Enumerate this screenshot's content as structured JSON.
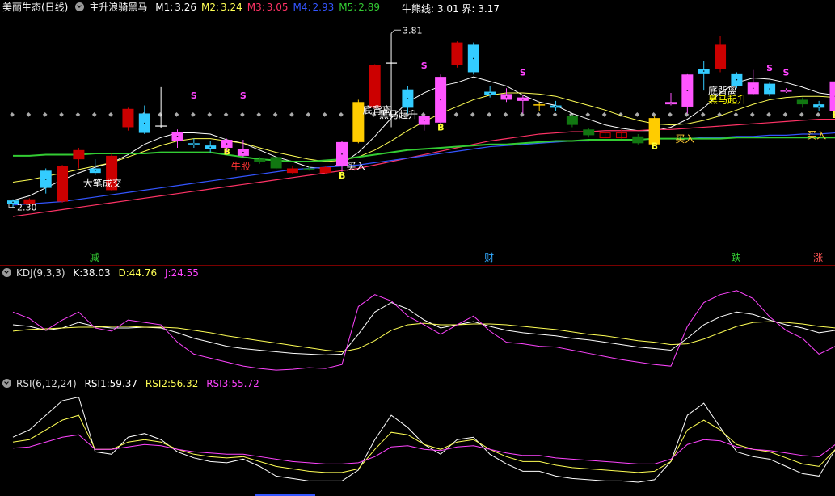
{
  "header": {
    "stock_title": "美丽生态(日线)",
    "indicator_name": "主升浪骑黑马",
    "ma": [
      {
        "label": "M1:",
        "value": "3.26",
        "color": "#ffffff"
      },
      {
        "label": "M2:",
        "value": "3.24",
        "color": "#ffff55"
      },
      {
        "label": "M3:",
        "value": "3.05",
        "color": "#ff3366"
      },
      {
        "label": "M4:",
        "value": "2.93",
        "color": "#3355ff"
      },
      {
        "label": "M5:",
        "value": "2.89",
        "color": "#33cc33"
      }
    ],
    "niu_label": "牛熊线:",
    "niu_value": "3.01",
    "jie_label": "界:",
    "jie_value": "3.17"
  },
  "kdj": {
    "title": "KDJ(9,3,3)",
    "k_label": "K:",
    "k_value": "38.03",
    "d_label": "D:",
    "d_value": "44.76",
    "j_label": "J:",
    "j_value": "24.55"
  },
  "rsi": {
    "title": "RSI(6,12,24)",
    "r1_label": "RSI1:",
    "r1_value": "59.37",
    "r2_label": "RSI2:",
    "r2_value": "56.32",
    "r3_label": "RSI3:",
    "r3_value": "55.72"
  },
  "chart_data": {
    "type": "candlestick",
    "price_range": [
      2.2,
      3.95
    ],
    "high_label": "3.81",
    "low_label": "2.30",
    "colors": {
      "up": "#cc0000",
      "down": "#33ccff",
      "doji": "#ffffff",
      "pink": "#ff55ff",
      "gold": "#ffcc00",
      "green": "#117711"
    },
    "candles": [
      {
        "o": 2.34,
        "c": 2.31,
        "h": 2.35,
        "l": 2.28,
        "col": "down"
      },
      {
        "o": 2.31,
        "c": 2.35,
        "h": 2.36,
        "l": 2.3,
        "col": "up"
      },
      {
        "o": 2.45,
        "c": 2.6,
        "h": 2.62,
        "l": 2.4,
        "col": "down"
      },
      {
        "o": 2.33,
        "c": 2.64,
        "h": 2.65,
        "l": 2.32,
        "col": "up"
      },
      {
        "o": 2.7,
        "c": 2.78,
        "h": 2.8,
        "l": 2.62,
        "col": "up"
      },
      {
        "o": 2.62,
        "c": 2.58,
        "h": 2.7,
        "l": 2.56,
        "col": "down"
      },
      {
        "o": 2.43,
        "c": 2.73,
        "h": 2.75,
        "l": 2.42,
        "col": "up"
      },
      {
        "o": 2.98,
        "c": 3.14,
        "h": 3.15,
        "l": 2.95,
        "col": "up"
      },
      {
        "o": 3.1,
        "c": 2.93,
        "h": 3.17,
        "l": 2.92,
        "col": "down"
      },
      {
        "o": 2.98,
        "c": 2.99,
        "h": 3.33,
        "l": 2.97,
        "col": "doji"
      },
      {
        "o": 2.86,
        "c": 2.94,
        "h": 2.96,
        "l": 2.8,
        "col": "pink"
      },
      {
        "o": 2.84,
        "c": 2.84,
        "h": 2.88,
        "l": 2.8,
        "col": "down"
      },
      {
        "o": 2.79,
        "c": 2.82,
        "h": 2.86,
        "l": 2.76,
        "col": "down"
      },
      {
        "o": 2.8,
        "c": 2.87,
        "h": 2.88,
        "l": 2.76,
        "col": "pink"
      },
      {
        "o": 2.73,
        "c": 2.79,
        "h": 2.87,
        "l": 2.72,
        "col": "pink"
      },
      {
        "o": 2.68,
        "c": 2.7,
        "h": 2.72,
        "l": 2.66,
        "col": "green"
      },
      {
        "o": 2.72,
        "c": 2.62,
        "h": 2.73,
        "l": 2.61,
        "col": "green"
      },
      {
        "o": 2.62,
        "c": 2.58,
        "h": 2.64,
        "l": 2.57,
        "col": "up"
      },
      {
        "o": 2.62,
        "c": 2.62,
        "h": 2.64,
        "l": 2.6,
        "col": "green"
      },
      {
        "o": 2.58,
        "c": 2.63,
        "h": 2.64,
        "l": 2.57,
        "col": "up"
      },
      {
        "o": 2.64,
        "c": 2.85,
        "h": 2.86,
        "l": 2.59,
        "col": "pink"
      },
      {
        "o": 2.85,
        "c": 3.2,
        "h": 3.22,
        "l": 2.84,
        "col": "gold"
      },
      {
        "o": 3.15,
        "c": 3.52,
        "h": 3.53,
        "l": 3.14,
        "col": "up"
      },
      {
        "o": 3.0,
        "c": 3.54,
        "h": 3.8,
        "l": 2.98,
        "col": "doji"
      },
      {
        "o": 3.15,
        "c": 3.31,
        "h": 3.34,
        "l": 3.1,
        "col": "down"
      },
      {
        "o": 3.0,
        "c": 3.08,
        "h": 3.1,
        "l": 2.95,
        "col": "pink"
      },
      {
        "o": 3.02,
        "c": 3.42,
        "h": 3.44,
        "l": 3.0,
        "col": "pink"
      },
      {
        "o": 3.52,
        "c": 3.72,
        "h": 3.73,
        "l": 3.5,
        "col": "up"
      },
      {
        "o": 3.7,
        "c": 3.46,
        "h": 3.72,
        "l": 3.44,
        "col": "down"
      },
      {
        "o": 3.26,
        "c": 3.29,
        "h": 3.34,
        "l": 3.24,
        "col": "down"
      },
      {
        "o": 3.22,
        "c": 3.27,
        "h": 3.32,
        "l": 3.2,
        "col": "pink"
      },
      {
        "o": 3.21,
        "c": 3.24,
        "h": 3.26,
        "l": 3.1,
        "col": "pink"
      },
      {
        "o": 3.18,
        "c": 3.17,
        "h": 3.2,
        "l": 3.12,
        "col": "gold"
      },
      {
        "o": 3.17,
        "c": 3.15,
        "h": 3.21,
        "l": 3.12,
        "col": "down"
      },
      {
        "o": 3.08,
        "c": 3.0,
        "h": 3.09,
        "l": 2.98,
        "col": "green"
      },
      {
        "o": 2.96,
        "c": 2.91,
        "h": 2.97,
        "l": 2.89,
        "col": "green"
      },
      {
        "o": 2.92,
        "c": 2.93,
        "h": 2.95,
        "l": 2.9,
        "col": "up"
      },
      {
        "o": 2.92,
        "c": 2.93,
        "h": 2.96,
        "l": 2.88,
        "col": "up"
      },
      {
        "o": 2.84,
        "c": 2.9,
        "h": 2.92,
        "l": 2.83,
        "col": "green"
      },
      {
        "o": 2.83,
        "c": 3.06,
        "h": 3.08,
        "l": 2.82,
        "col": "gold"
      },
      {
        "o": 3.18,
        "c": 3.2,
        "h": 3.28,
        "l": 3.17,
        "col": "pink"
      },
      {
        "o": 3.16,
        "c": 3.44,
        "h": 3.45,
        "l": 3.1,
        "col": "pink"
      },
      {
        "o": 3.45,
        "c": 3.49,
        "h": 3.56,
        "l": 3.3,
        "col": "down"
      },
      {
        "o": 3.49,
        "c": 3.7,
        "h": 3.78,
        "l": 3.46,
        "col": "up"
      },
      {
        "o": 3.45,
        "c": 3.34,
        "h": 3.46,
        "l": 3.32,
        "col": "down"
      },
      {
        "o": 3.37,
        "c": 3.27,
        "h": 3.48,
        "l": 3.26,
        "col": "pink"
      },
      {
        "o": 3.36,
        "c": 3.27,
        "h": 3.37,
        "l": 3.25,
        "col": "down"
      },
      {
        "o": 3.3,
        "c": 3.3,
        "h": 3.32,
        "l": 3.28,
        "col": "pink"
      },
      {
        "o": 3.18,
        "c": 3.22,
        "h": 3.24,
        "l": 3.15,
        "col": "green"
      },
      {
        "o": 3.15,
        "c": 3.18,
        "h": 3.21,
        "l": 3.12,
        "col": "down"
      },
      {
        "o": 3.12,
        "c": 3.38,
        "h": 3.4,
        "l": 3.1,
        "col": "pink"
      }
    ],
    "dots_level": 3.09,
    "ma_lines": {
      "M1": [
        2.34,
        2.38,
        2.45,
        2.52,
        2.58,
        2.63,
        2.67,
        2.74,
        2.83,
        2.89,
        2.93,
        2.93,
        2.92,
        2.87,
        2.84,
        2.78,
        2.72,
        2.68,
        2.63,
        2.62,
        2.66,
        2.76,
        2.9,
        3.06,
        3.2,
        3.28,
        3.34,
        3.37,
        3.42,
        3.38,
        3.34,
        3.26,
        3.2,
        3.17,
        3.1,
        3.05,
        3.0,
        2.97,
        2.95,
        2.95,
        2.98,
        3.05,
        3.15,
        3.28,
        3.37,
        3.41,
        3.4,
        3.37,
        3.33,
        3.28,
        3.26
      ],
      "M2": [
        2.5,
        2.52,
        2.55,
        2.58,
        2.61,
        2.64,
        2.67,
        2.72,
        2.77,
        2.82,
        2.86,
        2.88,
        2.88,
        2.86,
        2.84,
        2.8,
        2.76,
        2.73,
        2.7,
        2.68,
        2.69,
        2.72,
        2.78,
        2.86,
        2.95,
        3.03,
        3.1,
        3.16,
        3.22,
        3.26,
        3.28,
        3.28,
        3.27,
        3.25,
        3.21,
        3.17,
        3.13,
        3.08,
        3.04,
        3.01,
        3.0,
        3.01,
        3.04,
        3.08,
        3.13,
        3.18,
        3.22,
        3.24,
        3.25,
        3.25,
        3.24
      ],
      "M3": [
        2.2,
        2.22,
        2.24,
        2.26,
        2.28,
        2.3,
        2.32,
        2.34,
        2.36,
        2.38,
        2.4,
        2.42,
        2.44,
        2.46,
        2.48,
        2.5,
        2.52,
        2.54,
        2.56,
        2.58,
        2.6,
        2.62,
        2.65,
        2.68,
        2.71,
        2.74,
        2.77,
        2.8,
        2.83,
        2.86,
        2.88,
        2.9,
        2.92,
        2.93,
        2.94,
        2.94,
        2.95,
        2.95,
        2.95,
        2.96,
        2.96,
        2.97,
        2.98,
        2.99,
        3.0,
        3.01,
        3.02,
        3.03,
        3.04,
        3.05,
        3.05
      ],
      "M4": [
        2.3,
        2.31,
        2.32,
        2.33,
        2.35,
        2.37,
        2.39,
        2.41,
        2.43,
        2.45,
        2.47,
        2.49,
        2.51,
        2.53,
        2.55,
        2.57,
        2.59,
        2.61,
        2.62,
        2.63,
        2.64,
        2.65,
        2.67,
        2.69,
        2.71,
        2.73,
        2.75,
        2.77,
        2.79,
        2.81,
        2.82,
        2.83,
        2.84,
        2.85,
        2.86,
        2.86,
        2.87,
        2.87,
        2.87,
        2.88,
        2.88,
        2.88,
        2.89,
        2.89,
        2.9,
        2.9,
        2.91,
        2.91,
        2.92,
        2.92,
        2.93
      ],
      "M5": [
        2.73,
        2.73,
        2.74,
        2.74,
        2.74,
        2.75,
        2.75,
        2.75,
        2.75,
        2.76,
        2.76,
        2.76,
        2.76,
        2.74,
        2.72,
        2.7,
        2.69,
        2.68,
        2.68,
        2.69,
        2.7,
        2.72,
        2.74,
        2.76,
        2.78,
        2.79,
        2.8,
        2.81,
        2.82,
        2.83,
        2.83,
        2.84,
        2.85,
        2.86,
        2.86,
        2.87,
        2.87,
        2.87,
        2.87,
        2.88,
        2.88,
        2.88,
        2.88,
        2.88,
        2.89,
        2.89,
        2.89,
        2.89,
        2.89,
        2.89,
        2.89
      ]
    },
    "annotations": [
      {
        "text": "大笔成交",
        "i": 5,
        "price": 2.46,
        "color": "#ffffff"
      },
      {
        "text": "牛股",
        "i": 14,
        "price": 2.61,
        "color": "#ff3333"
      },
      {
        "text": "买入",
        "i": 21,
        "price": 2.61,
        "color": "#ffffff"
      },
      {
        "text": "底背离",
        "i": 22,
        "price": 3.1,
        "color": "#ffffff"
      },
      {
        "text": "黑马起升",
        "i": 23,
        "price": 3.06,
        "color": "#ffffff"
      },
      {
        "text": "买入",
        "i": 41,
        "price": 2.85,
        "color": "#ffcc33"
      },
      {
        "text": "底背离",
        "i": 43,
        "price": 3.27,
        "color": "#ffffff"
      },
      {
        "text": "黑马起升",
        "i": 43,
        "price": 3.19,
        "color": "#ffff00"
      },
      {
        "text": "买入",
        "i": 49,
        "price": 2.88,
        "color": "#ffcc33"
      }
    ],
    "markers": [
      {
        "text": "S",
        "i": 11,
        "price": 3.23,
        "color": "#ff44ff"
      },
      {
        "text": "S",
        "i": 14,
        "price": 3.23,
        "color": "#ff44ff"
      },
      {
        "text": "S",
        "i": 25,
        "price": 3.49,
        "color": "#ff44ff"
      },
      {
        "text": "S",
        "i": 31,
        "price": 3.43,
        "color": "#ff44ff"
      },
      {
        "text": "S",
        "i": 46,
        "price": 3.47,
        "color": "#ff44ff"
      },
      {
        "text": "S",
        "i": 47,
        "price": 3.43,
        "color": "#ff44ff"
      },
      {
        "text": "B",
        "i": 13,
        "price": 2.74,
        "color": "#ffff33"
      },
      {
        "text": "B",
        "i": 20,
        "price": 2.53,
        "color": "#ffff33"
      },
      {
        "text": "B",
        "i": 26,
        "price": 2.95,
        "color": "#ffff33"
      },
      {
        "text": "B",
        "i": 39,
        "price": 2.79,
        "color": "#ffff33"
      },
      {
        "text": "B",
        "i": 50,
        "price": 3.06,
        "color": "#ffff33"
      }
    ],
    "bottom_labels": [
      {
        "text": "减",
        "i": 5,
        "color": "#33cc33"
      },
      {
        "text": "财",
        "i": 29,
        "color": "#33aaff"
      },
      {
        "text": "跌",
        "i": 44,
        "color": "#33cc33"
      },
      {
        "text": "涨",
        "i": 49,
        "color": "#ff5555"
      }
    ],
    "kdj_range": [
      -10,
      110
    ],
    "kdj_k": [
      52,
      50,
      45,
      48,
      55,
      50,
      48,
      48,
      49,
      48,
      42,
      35,
      30,
      25,
      22,
      20,
      18,
      16,
      15,
      14,
      15,
      40,
      68,
      80,
      72,
      58,
      48,
      52,
      56,
      50,
      45,
      42,
      40,
      38,
      35,
      33,
      30,
      27,
      24,
      22,
      20,
      35,
      52,
      62,
      68,
      65,
      58,
      52,
      48,
      42,
      45
    ],
    "kdj_d": [
      44,
      46,
      47,
      48,
      49,
      49,
      50,
      50,
      49,
      49,
      48,
      45,
      42,
      38,
      35,
      32,
      29,
      26,
      23,
      20,
      18,
      22,
      32,
      45,
      52,
      54,
      52,
      52,
      53,
      53,
      52,
      50,
      48,
      46,
      43,
      40,
      38,
      35,
      32,
      30,
      27,
      28,
      34,
      42,
      50,
      55,
      56,
      55,
      53,
      50,
      48
    ],
    "kdj_j": [
      68,
      60,
      45,
      58,
      68,
      48,
      44,
      58,
      55,
      52,
      30,
      15,
      10,
      5,
      0,
      -3,
      -5,
      -4,
      -2,
      -3,
      2,
      75,
      90,
      82,
      63,
      52,
      40,
      52,
      63,
      44,
      30,
      28,
      25,
      24,
      20,
      16,
      12,
      8,
      5,
      2,
      0,
      50,
      80,
      90,
      95,
      85,
      62,
      45,
      35,
      15,
      25
    ],
    "rsi_range": [
      15,
      100
    ],
    "rsi1": [
      62,
      68,
      80,
      92,
      95,
      50,
      48,
      62,
      65,
      60,
      50,
      45,
      42,
      41,
      44,
      38,
      30,
      28,
      26,
      26,
      26,
      35,
      60,
      80,
      70,
      56,
      48,
      60,
      62,
      48,
      40,
      34,
      34,
      30,
      28,
      27,
      26,
      26,
      25,
      27,
      42,
      80,
      90,
      70,
      50,
      46,
      44,
      38,
      32,
      30,
      52
    ],
    "rsi2": [
      58,
      60,
      68,
      76,
      80,
      52,
      52,
      58,
      60,
      58,
      52,
      48,
      46,
      45,
      46,
      42,
      38,
      36,
      34,
      33,
      33,
      36,
      52,
      66,
      64,
      56,
      52,
      58,
      60,
      52,
      46,
      42,
      42,
      39,
      37,
      36,
      35,
      34,
      33,
      34,
      42,
      68,
      76,
      68,
      56,
      52,
      50,
      45,
      40,
      38,
      52
    ],
    "rsi3": [
      53,
      54,
      58,
      62,
      64,
      52,
      52,
      54,
      56,
      55,
      52,
      50,
      49,
      48,
      48,
      46,
      44,
      42,
      41,
      40,
      40,
      41,
      46,
      54,
      55,
      52,
      51,
      54,
      55,
      52,
      49,
      47,
      47,
      45,
      44,
      43,
      42,
      41,
      40,
      40,
      44,
      56,
      60,
      59,
      54,
      52,
      51,
      49,
      47,
      46,
      56
    ]
  }
}
